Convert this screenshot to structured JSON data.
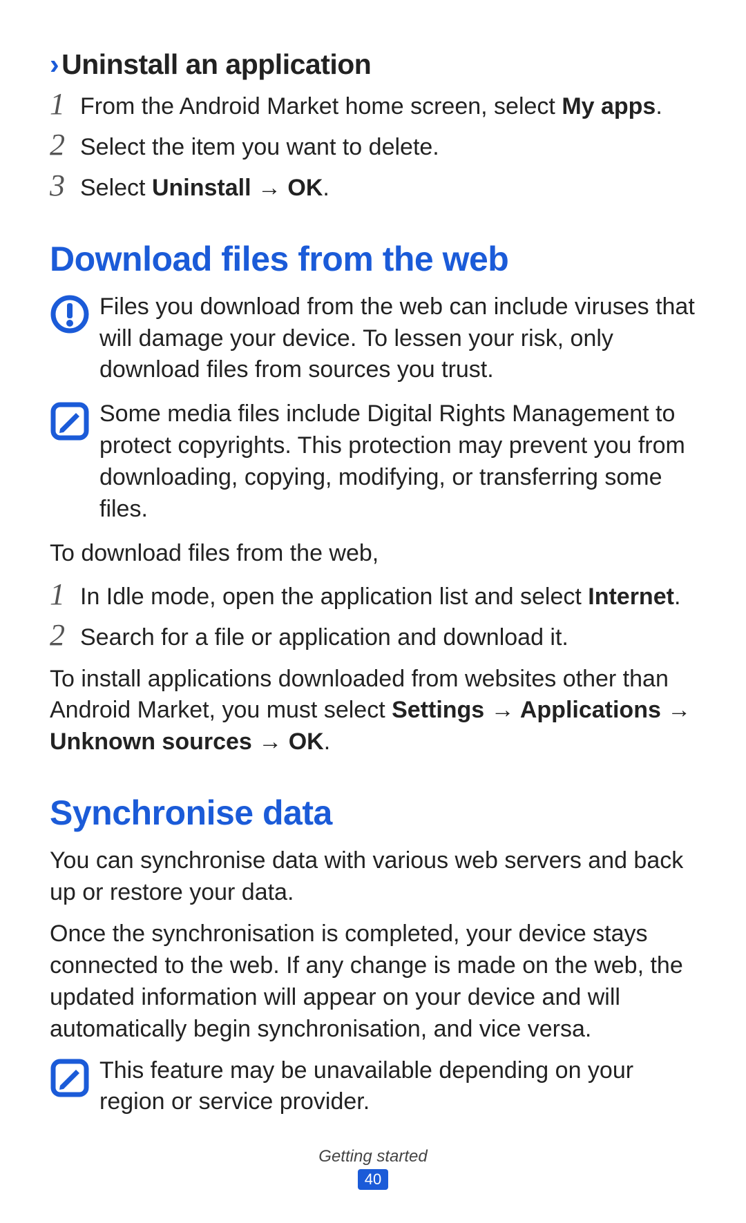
{
  "uninstall": {
    "heading": "Uninstall an application",
    "steps": [
      {
        "pre": "From the Android Market home screen, select ",
        "bold": "My apps",
        "post": "."
      },
      {
        "pre": "Select the item you want to delete.",
        "bold": "",
        "post": ""
      },
      {
        "pre": "Select ",
        "bold": "Uninstall → OK",
        "post": "."
      }
    ]
  },
  "download": {
    "heading": "Download files from the web",
    "warning": "Files you download from the web can include viruses that will damage your device. To lessen your risk, only download files from sources you trust.",
    "note": "Some media files include Digital Rights Management to protect copyrights. This protection may prevent you from downloading, copying, modifying, or transferring some files.",
    "intro": "To download files from the web,",
    "steps": [
      {
        "pre": "In Idle mode, open the application list and select ",
        "bold": "Internet",
        "post": "."
      },
      {
        "pre": "Search for a file or application and download it.",
        "bold": "",
        "post": ""
      }
    ],
    "install_pre": "To install applications downloaded from websites other than Android Market, you must select ",
    "install_bold": "Settings → Applications → Unknown sources → OK",
    "install_post": "."
  },
  "sync": {
    "heading": "Synchronise data",
    "p1": "You can synchronise data with various web servers and back up or restore your data.",
    "p2": "Once the synchronisation is completed, your device stays connected to the web. If any change is made on the web, the updated information will appear on your device and will automatically begin synchronisation, and vice versa.",
    "note": "This feature may be unavailable depending on your region or service provider."
  },
  "footer": {
    "section": "Getting started",
    "page": "40"
  }
}
